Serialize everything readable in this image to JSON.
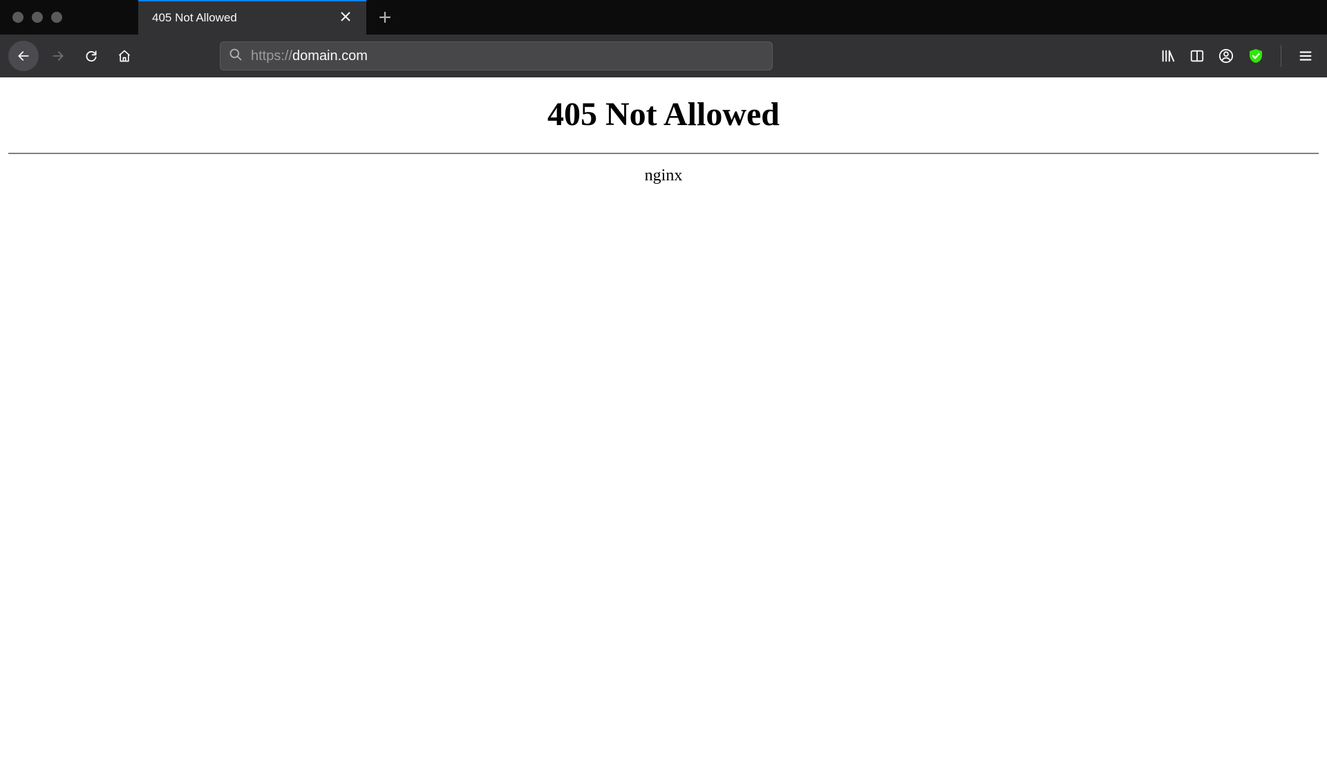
{
  "browser": {
    "tab_title": "405 Not Allowed",
    "url_prefix": "https://",
    "url_host": "domain.com"
  },
  "page": {
    "heading": "405 Not Allowed",
    "server": "nginx"
  }
}
